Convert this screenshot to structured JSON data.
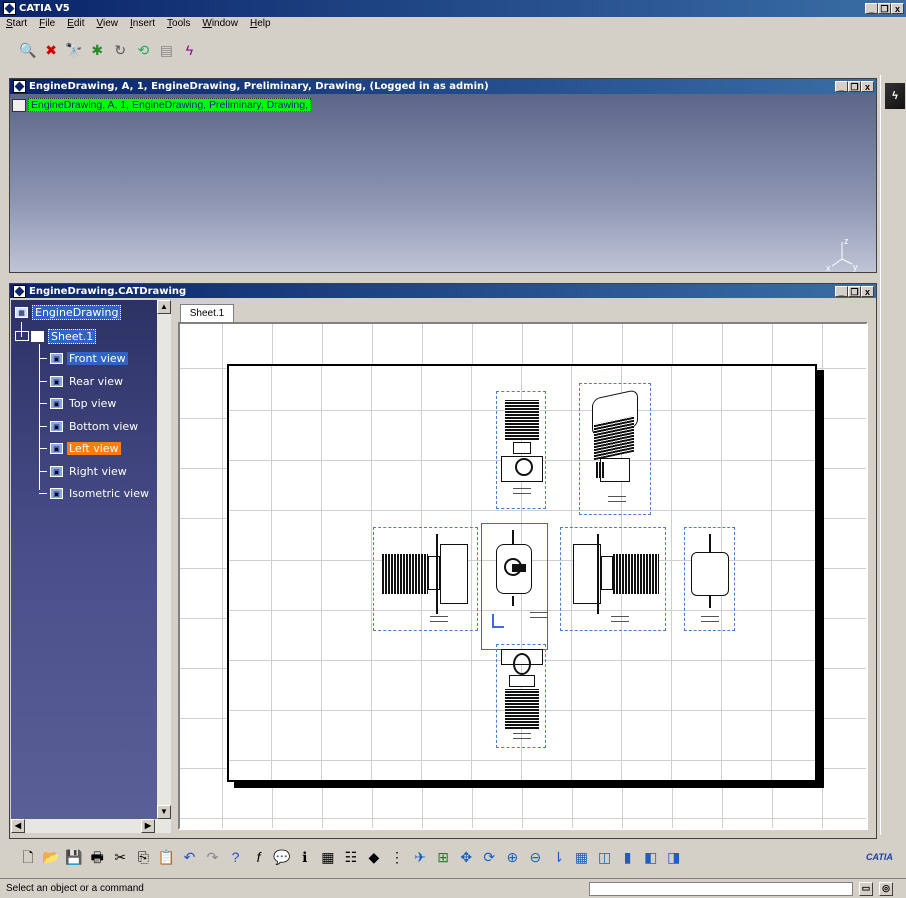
{
  "app": {
    "title": "CATIA V5",
    "menu": [
      "Start",
      "File",
      "Edit",
      "View",
      "Insert",
      "Tools",
      "Window",
      "Help"
    ]
  },
  "pdm_window": {
    "title": "EngineDrawing, A, 1, EngineDrawing, Preliminary, Drawing,  (Logged in as admin)",
    "item_label": "EngineDrawing, A, 1, EngineDrawing, Preliminary, Drawing,",
    "axis": {
      "z": "z",
      "x": "x",
      "y": "y"
    }
  },
  "drawing_window": {
    "title": "EngineDrawing.CATDrawing",
    "sheet_tab": "Sheet.1",
    "tree": {
      "root": "EngineDrawing",
      "sheet": "Sheet.1",
      "views": [
        "Front view",
        "Rear view",
        "Top view",
        "Bottom view",
        "Left view",
        "Right view",
        "Isometric view"
      ],
      "selected_view": "Front view",
      "highlighted_view": "Left view"
    }
  },
  "status": {
    "message": "Select an object or a command",
    "command_input": ""
  },
  "brand": {
    "logo_text": "CATIA"
  },
  "colors": {
    "title_bar": "#0a246a",
    "tree_bg": "#3a3f7a",
    "highlight": "#f87d10",
    "pdm_item_bg": "#00ff00",
    "view_frame": "#4a7fd0",
    "active_view_frame": "#e03030"
  }
}
